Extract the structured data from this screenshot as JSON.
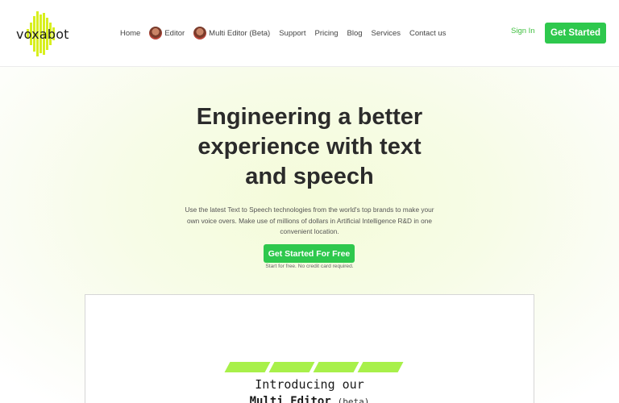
{
  "brand": {
    "name": "voxabot",
    "accent_color": "#d8ef1e"
  },
  "nav": {
    "items": [
      {
        "label": "Home",
        "avatar": false
      },
      {
        "label": "Editor",
        "avatar": true
      },
      {
        "label": "Multi Editor (Beta)",
        "avatar": true
      },
      {
        "label": "Support",
        "avatar": false
      },
      {
        "label": "Pricing",
        "avatar": false
      },
      {
        "label": "Blog",
        "avatar": false
      },
      {
        "label": "Services",
        "avatar": false
      },
      {
        "label": "Contact us",
        "avatar": false
      }
    ],
    "sign_in": "Sign In",
    "get_started": "Get Started",
    "button_color": "#2ec84d"
  },
  "hero": {
    "title_line1": "Engineering a better",
    "title_line2": "experience with text",
    "title_line3": "and speech",
    "subtitle_line1": "Use the latest Text to Speech technologies from the world's top brands to make your",
    "subtitle_line2": "own voice overs. Make use of millions of dollars in Artificial Intelligence R&D in one",
    "subtitle_line3": "convenient location.",
    "cta": "Get Started For Free",
    "cta_note": "Start for free. No credit card required."
  },
  "panel": {
    "intro": "Introducing our",
    "product": "Multi Editor",
    "badge": "(beta)",
    "stripe_color": "#a8f04a"
  }
}
